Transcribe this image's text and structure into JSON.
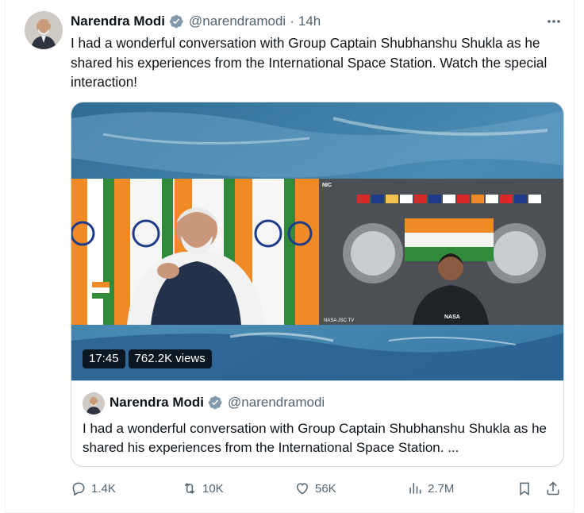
{
  "tweet": {
    "author_name": "Narendra Modi",
    "handle": "@narendramodi",
    "separator": "·",
    "time": "14h",
    "text": "I had a wonderful conversation with Group Captain Shubhanshu Shukla as he shared his experiences from the International Space Station. Watch the special interaction!"
  },
  "video": {
    "duration": "17:45",
    "views": "762.2K views",
    "overlay_left": "NIC",
    "overlay_nasa_tv": "NASA JSC TV",
    "overlay_nasa_logo": "NASA"
  },
  "quote": {
    "author_name": "Narendra Modi",
    "handle": "@narendramodi",
    "text": "I had a wonderful conversation with Group Captain Shubhanshu Shukla as he shared his experiences from the International Space Station. ..."
  },
  "actions": {
    "replies": "1.4K",
    "reposts": "10K",
    "likes": "56K",
    "views": "2.7M"
  },
  "colors": {
    "text_primary": "#0f1419",
    "text_secondary": "#536471",
    "verified_blue": "#1d9bf0",
    "border": "#cfd9de"
  },
  "icons": [
    "more-icon",
    "verified-icon",
    "reply-icon",
    "repost-icon",
    "like-icon",
    "views-icon",
    "bookmark-icon",
    "share-icon"
  ]
}
